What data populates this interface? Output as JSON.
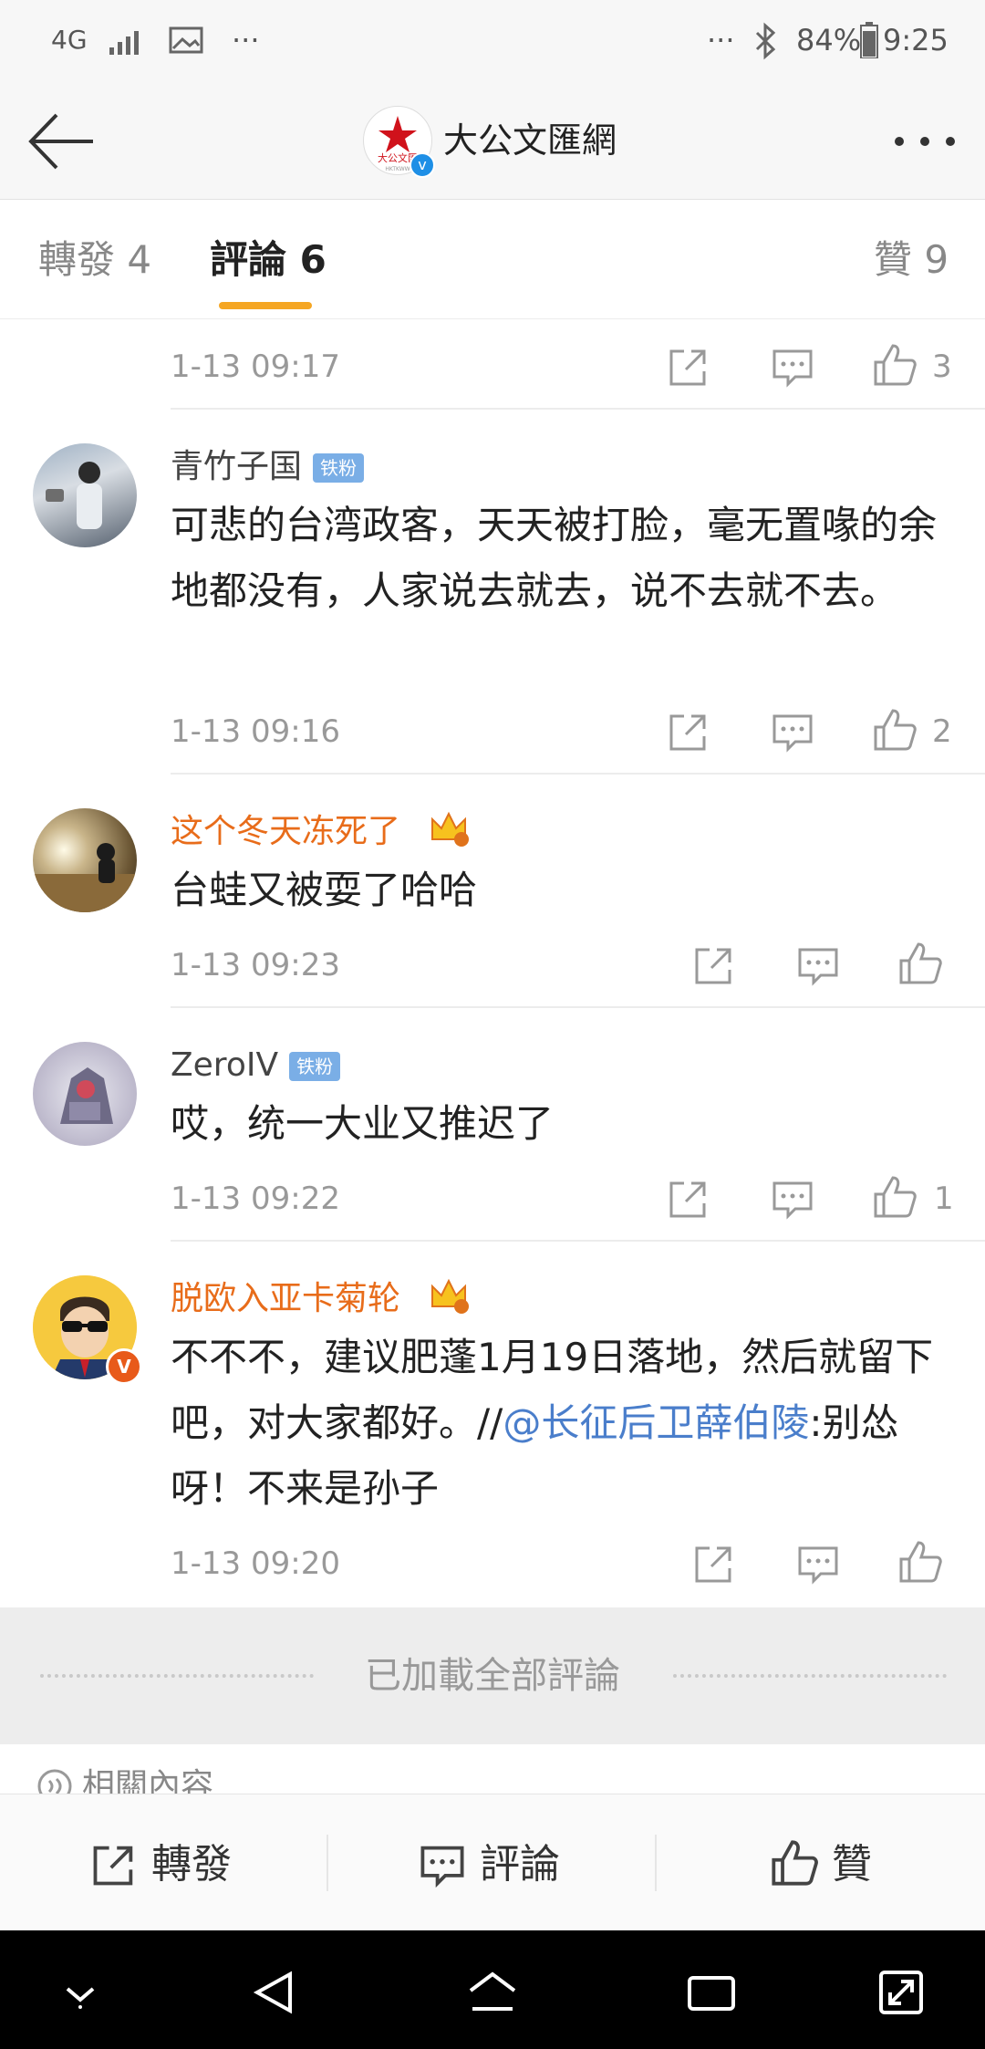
{
  "status_bar": {
    "network": "4G",
    "more": "···",
    "overflow": "···",
    "battery": "84%",
    "time": "9:25"
  },
  "header": {
    "title": "大公文匯網",
    "logo_text": "大公文匯",
    "logo_sub": "HKTKWW"
  },
  "tabs": [
    {
      "label": "轉發 4"
    },
    {
      "label": "評論 6"
    },
    {
      "label": "贊 9"
    }
  ],
  "comments": [
    {
      "name": "",
      "text": "",
      "date": "1-13 09:17",
      "likes": "3"
    },
    {
      "name": "青竹子国",
      "badge": "铁粉",
      "text": "可悲的台湾政客，天天被打脸，毫无置喙的余地都没有，人家说去就去，说不去就不去。",
      "date": "1-13 09:16",
      "likes": "2"
    },
    {
      "name": "这个冬天冻死了",
      "text": "台蛙又被耍了哈哈",
      "date": "1-13 09:23",
      "likes": ""
    },
    {
      "name": "ZeroIV",
      "badge": "铁粉",
      "text": "哎，统一大业又推迟了",
      "date": "1-13 09:22",
      "likes": "1"
    },
    {
      "name": "脱欧入亚卡菊轮",
      "text_part1": "不不不，建议肥蓬1月19日落地，然后就留下吧，对大家都好。//",
      "mention": "@长征后卫薛伯陵",
      "text_part2": ":别怂呀！不来是孙子",
      "date": "1-13 09:20",
      "likes": ""
    }
  ],
  "footer": {
    "loaded_all": "已加載全部評論",
    "related": "相關內容"
  },
  "action_bar": {
    "repost": "轉發",
    "comment": "評論",
    "like": "贊"
  },
  "colors": {
    "accent": "#f5a623",
    "vip_name": "#e86c1a",
    "mention": "#4a7ecb",
    "badge": "#7aaee6"
  }
}
